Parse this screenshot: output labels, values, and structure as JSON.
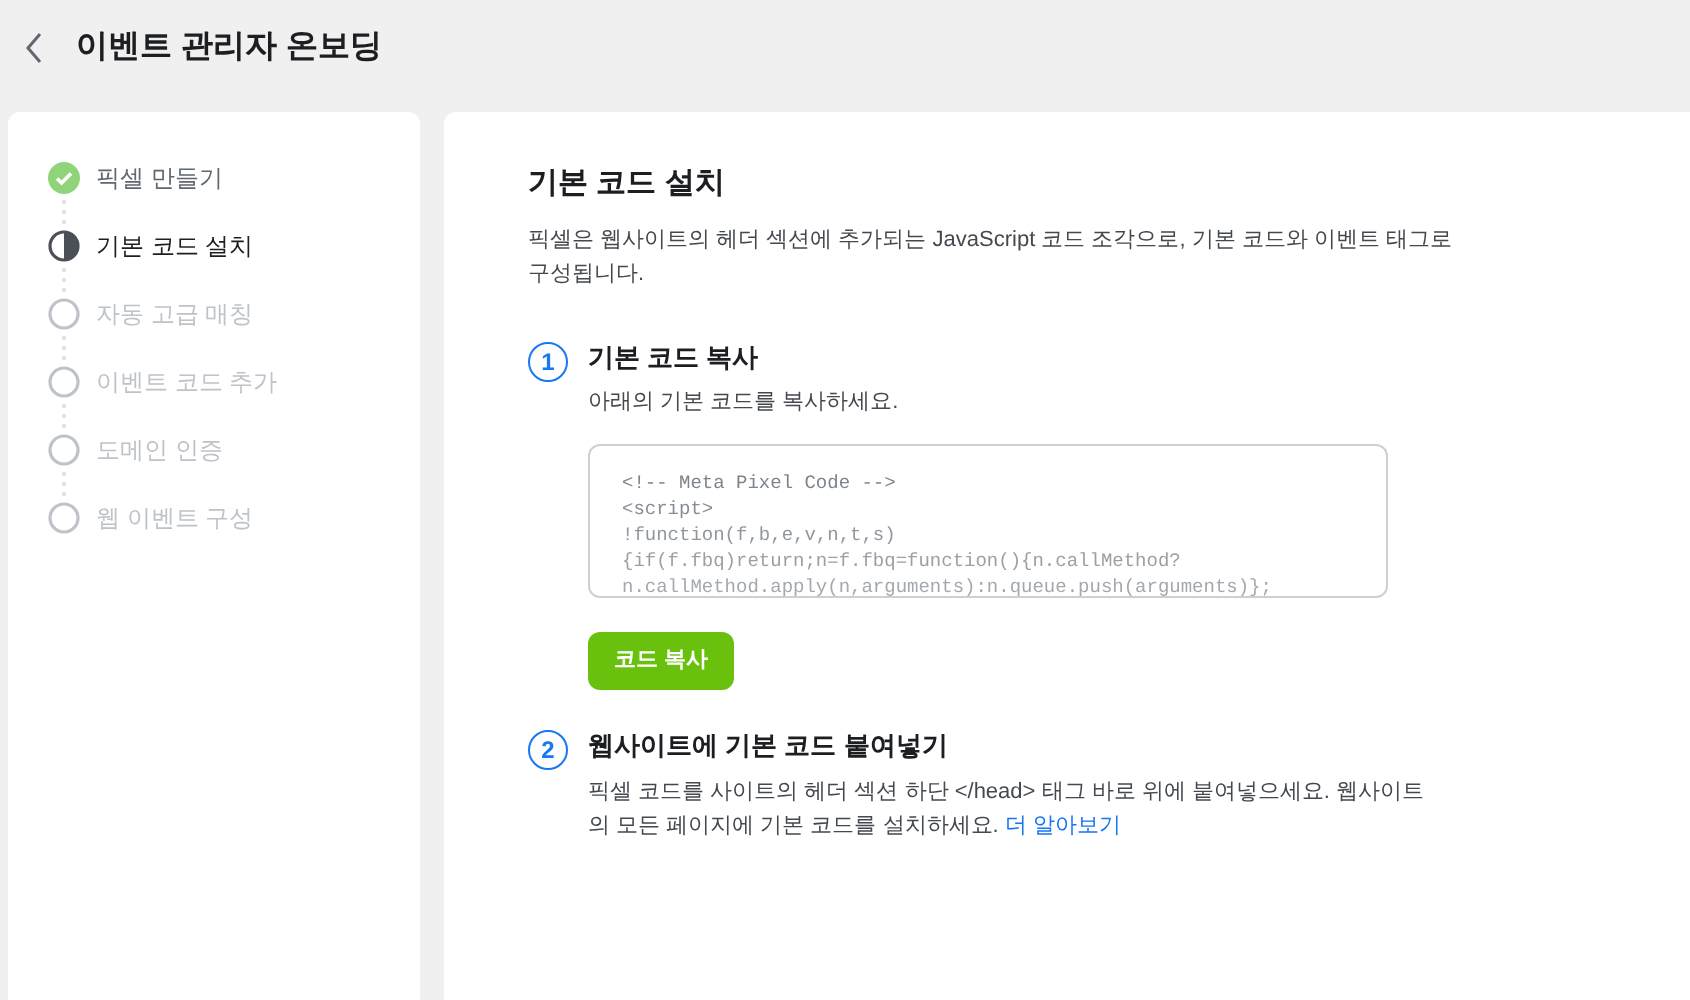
{
  "header": {
    "title": "이벤트 관리자 온보딩"
  },
  "steps": [
    {
      "label": "픽셀 만들기",
      "completed": true,
      "selected": false
    },
    {
      "label": "기본 코드 설치",
      "completed": false,
      "selected": true
    },
    {
      "label": "자동 고급 매칭",
      "completed": false,
      "selected": false
    },
    {
      "label": "이벤트 코드 추가",
      "completed": false,
      "selected": false
    },
    {
      "label": "도메인 인증",
      "completed": false,
      "selected": false
    },
    {
      "label": "웹 이벤트 구성",
      "completed": false,
      "selected": false
    }
  ],
  "section": {
    "title": "기본 코드 설치",
    "description": "픽셀은 웹사이트의 헤더 섹션에 추가되는 JavaScript 코드 조각으로, 기본 코드와 이벤트 태그로 구성됩니다."
  },
  "instructions": [
    {
      "number": "1",
      "title": "기본 코드 복사",
      "text": "아래의 기본 코드를 복사하세요.",
      "code": [
        "<!-- Meta Pixel Code -->",
        "<script>",
        "!function(f,b,e,v,n,t,s)",
        "{if(f.fbq)return;n=f.fbq=function(){n.callMethod?",
        "n.callMethod.apply(n,arguments):n.queue.push(arguments)};"
      ],
      "button": "코드 복사"
    },
    {
      "number": "2",
      "title": "웹사이트에 기본 코드 붙여넣기",
      "text": "픽셀 코드를 사이트의 헤더 섹션 하단 </head> 태그 바로 위에 붙여넣으세요. 웹사이트의 모든 페이지에 기본 코드를 설치하세요.",
      "link": "더 알아보기"
    }
  ]
}
